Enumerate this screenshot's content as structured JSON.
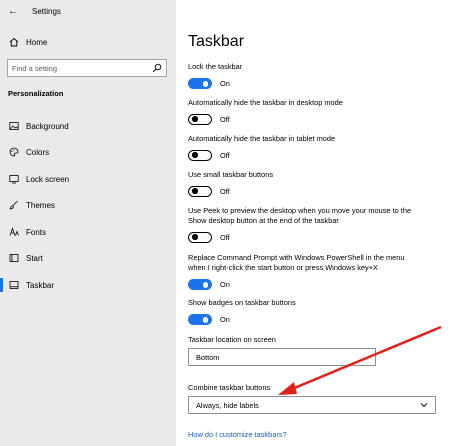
{
  "window": {
    "title": "Settings"
  },
  "sidebar": {
    "home_label": "Home",
    "search_placeholder": "Find a setting",
    "section_heading": "Personalization",
    "items": [
      {
        "label": "Background",
        "icon": "image-icon"
      },
      {
        "label": "Colors",
        "icon": "palette-icon"
      },
      {
        "label": "Lock screen",
        "icon": "lock-screen-icon"
      },
      {
        "label": "Themes",
        "icon": "brush-icon"
      },
      {
        "label": "Fonts",
        "icon": "font-icon"
      },
      {
        "label": "Start",
        "icon": "start-icon"
      },
      {
        "label": "Taskbar",
        "icon": "taskbar-icon",
        "active": true
      }
    ]
  },
  "main": {
    "title": "Taskbar",
    "settings": [
      {
        "label": "Lock the taskbar",
        "state": "On"
      },
      {
        "label": "Automatically hide the taskbar in desktop mode",
        "state": "Off"
      },
      {
        "label": "Automatically hide the taskbar in tablet mode",
        "state": "Off"
      },
      {
        "label": "Use small taskbar buttons",
        "state": "Off"
      },
      {
        "label_line1": "Use Peek to preview the desktop when you move your mouse to the",
        "label_line2": "Show desktop button at the end of the taskbar",
        "state": "Off"
      },
      {
        "label_line1": "Replace Command Prompt with Windows PowerShell in the menu",
        "label_line2": "when I right-click the start button or press Windows key+X",
        "state": "On"
      },
      {
        "label": "Show badges on taskbar buttons",
        "state": "On"
      }
    ],
    "location": {
      "label": "Taskbar location on screen",
      "value": "Bottom"
    },
    "combine": {
      "label": "Combine taskbar buttons",
      "value": "Always, hide labels"
    },
    "help_link": "How do I customize taskbars?"
  },
  "colors": {
    "accent": "#1a73e8",
    "sidebar_bg": "#eaeaea",
    "annotation_arrow": "#e0201a"
  }
}
